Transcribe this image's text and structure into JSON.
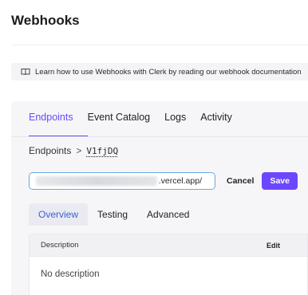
{
  "header": {
    "title": "Webhooks"
  },
  "banner": {
    "text": "Learn how to use Webhooks with Clerk by reading our webhook documentation"
  },
  "tabs": [
    {
      "label": "Endpoints",
      "active": true
    },
    {
      "label": "Event Catalog",
      "active": false
    },
    {
      "label": "Logs",
      "active": false
    },
    {
      "label": "Activity",
      "active": false
    }
  ],
  "breadcrumb": {
    "root": "Endpoints",
    "separator": ">",
    "current": "V1fjDQ"
  },
  "endpoint": {
    "url_suffix": ".vercel.app/",
    "cancel_label": "Cancel",
    "save_label": "Save"
  },
  "subtabs": [
    {
      "label": "Overview",
      "active": true
    },
    {
      "label": "Testing",
      "active": false
    },
    {
      "label": "Advanced",
      "active": false
    }
  ],
  "description": {
    "header": "Description",
    "edit_label": "Edit",
    "empty_text": "No description"
  },
  "colors": {
    "accent": "#6c47ff",
    "input_focus": "#6aa6e6",
    "subtab_active_text": "#3c64c8"
  }
}
